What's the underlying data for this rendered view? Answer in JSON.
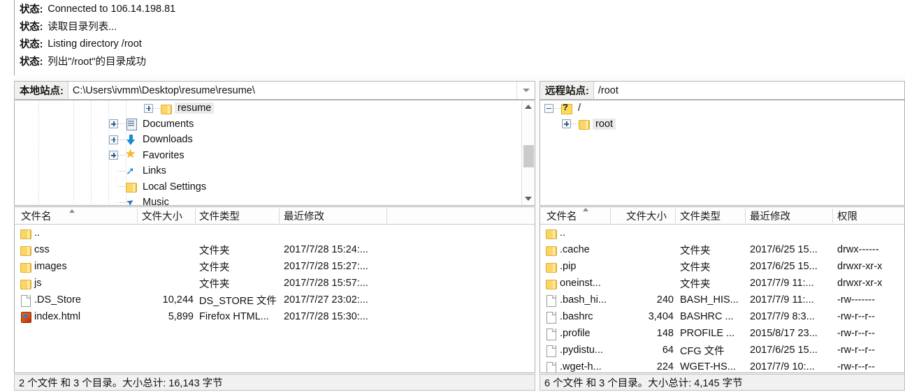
{
  "log": {
    "label": "状态:",
    "messages": [
      "Connected to 106.14.198.81",
      "读取目录列表...",
      "Listing directory /root",
      "列出\"/root\"的目录成功"
    ]
  },
  "local": {
    "path_label": "本地站点:",
    "path_value": "C:\\Users\\ivmm\\Desktop\\resume\\resume\\",
    "chevron_icon": "chevron-down-icon",
    "tree": [
      {
        "label": "resume",
        "icon": "folder-icon",
        "expander": "plus",
        "indent": 205,
        "selected": true
      },
      {
        "label": "Documents",
        "icon": "documents-icon",
        "expander": "plus",
        "indent": 155,
        "selected": false
      },
      {
        "label": "Downloads",
        "icon": "download-icon",
        "expander": "plus",
        "indent": 155,
        "selected": false
      },
      {
        "label": "Favorites",
        "icon": "star-icon",
        "expander": "plus",
        "indent": 155,
        "selected": false
      },
      {
        "label": "Links",
        "icon": "link-icon",
        "expander": "none",
        "indent": 155,
        "selected": false
      },
      {
        "label": "Local Settings",
        "icon": "folder-icon",
        "expander": "none",
        "indent": 155,
        "selected": false
      },
      {
        "label": "Music",
        "icon": "music-icon",
        "expander": "none",
        "indent": 155,
        "selected": false
      }
    ],
    "columns": [
      "文件名",
      "文件大小",
      "文件类型",
      "最近修改"
    ],
    "sort_column": 0,
    "rows": [
      {
        "name": "..",
        "icon": "folder-icon",
        "size": "",
        "type": "",
        "modified": ""
      },
      {
        "name": "css",
        "icon": "folder-icon",
        "size": "",
        "type": "文件夹",
        "modified": "2017/7/28 15:24:..."
      },
      {
        "name": "images",
        "icon": "folder-icon",
        "size": "",
        "type": "文件夹",
        "modified": "2017/7/28 15:27:..."
      },
      {
        "name": "js",
        "icon": "folder-icon",
        "size": "",
        "type": "文件夹",
        "modified": "2017/7/28 15:57:..."
      },
      {
        "name": ".DS_Store",
        "icon": "file-icon",
        "size": "10,244",
        "type": "DS_STORE 文件",
        "modified": "2017/7/27 23:02:..."
      },
      {
        "name": "index.html",
        "icon": "firefox-icon",
        "size": "5,899",
        "type": "Firefox HTML...",
        "modified": "2017/7/28 15:30:..."
      }
    ],
    "status": "2 个文件 和 3 个目录。大小总计: 16,143 字节"
  },
  "remote": {
    "path_label": "远程站点:",
    "path_value": "/root",
    "tree": [
      {
        "label": "/",
        "icon": "question-folder-icon",
        "expander": "minus",
        "indent": 6,
        "selected": false
      },
      {
        "label": "root",
        "icon": "folder-icon",
        "expander": "plus",
        "indent": 31,
        "selected": true
      }
    ],
    "columns": [
      "文件名",
      "文件大小",
      "文件类型",
      "最近修改",
      "权限"
    ],
    "sort_column": 0,
    "rows": [
      {
        "name": "..",
        "icon": "folder-icon",
        "size": "",
        "type": "",
        "modified": "",
        "perm": ""
      },
      {
        "name": ".cache",
        "icon": "folder-icon",
        "size": "",
        "type": "文件夹",
        "modified": "2017/6/25 15...",
        "perm": "drwx------"
      },
      {
        "name": ".pip",
        "icon": "folder-icon",
        "size": "",
        "type": "文件夹",
        "modified": "2017/6/25 15...",
        "perm": "drwxr-xr-x"
      },
      {
        "name": "oneinst...",
        "icon": "folder-icon",
        "size": "",
        "type": "文件夹",
        "modified": "2017/7/9 11:...",
        "perm": "drwxr-xr-x"
      },
      {
        "name": ".bash_hi...",
        "icon": "file-icon",
        "size": "240",
        "type": "BASH_HIS...",
        "modified": "2017/7/9 11:...",
        "perm": "-rw-------"
      },
      {
        "name": ".bashrc",
        "icon": "file-icon",
        "size": "3,404",
        "type": "BASHRC ...",
        "modified": "2017/7/9 8:3...",
        "perm": "-rw-r--r--"
      },
      {
        "name": ".profile",
        "icon": "file-icon",
        "size": "148",
        "type": "PROFILE ...",
        "modified": "2015/8/17 23...",
        "perm": "-rw-r--r--"
      },
      {
        "name": ".pydistu...",
        "icon": "file-icon",
        "size": "64",
        "type": "CFG 文件",
        "modified": "2017/6/25 15...",
        "perm": "-rw-r--r--"
      },
      {
        "name": ".wget-h...",
        "icon": "file-icon",
        "size": "224",
        "type": "WGET-HS...",
        "modified": "2017/7/9 10:...",
        "perm": "-rw-r--r--"
      }
    ],
    "status": "6 个文件 和 3 个目录。大小总计: 4,145 字节"
  },
  "scrollbar": {
    "name": "local-tree-scrollbar"
  }
}
